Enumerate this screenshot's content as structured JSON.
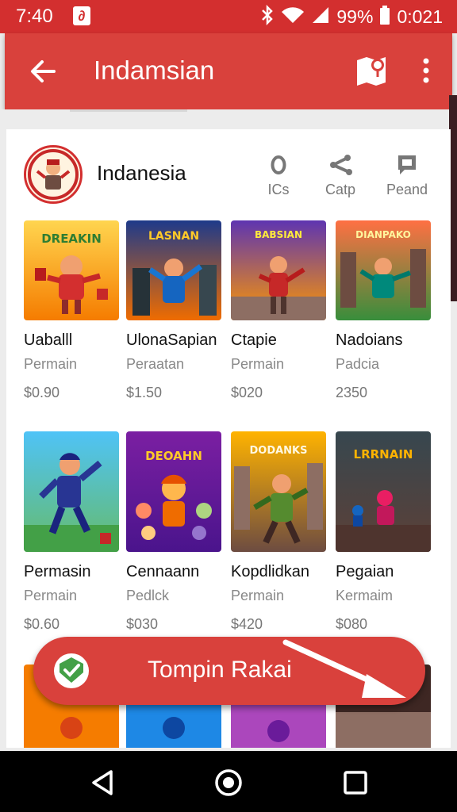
{
  "status_bar": {
    "time": "7:40",
    "battery": "99%",
    "clock": "0:021",
    "icons": [
      "notification-icon",
      "bluetooth-icon",
      "wifi-icon",
      "signal-icon",
      "battery-icon"
    ]
  },
  "app_bar": {
    "title": "Indamsian",
    "icons": [
      "back-arrow-icon",
      "map-pin-icon",
      "more-vert-icon"
    ]
  },
  "developer": {
    "name": "Indanesia",
    "stats": [
      {
        "label": "ICs",
        "icon": "circle-icon"
      },
      {
        "label": "Catp",
        "icon": "share-icon"
      },
      {
        "label": "Peand",
        "icon": "comment-icon"
      }
    ]
  },
  "apps": [
    {
      "name": "Uaballl",
      "sub": "Permain",
      "price": "$0.90"
    },
    {
      "name": "UlonaSapian",
      "sub": "Peraatan",
      "price": "$1.50"
    },
    {
      "name": "Ctapie",
      "sub": "Permain",
      "price": "$020"
    },
    {
      "name": "Nadoians",
      "sub": "Padcia",
      "price": "2350"
    },
    {
      "name": "Permasin",
      "sub": "Permain",
      "price": "$0.60"
    },
    {
      "name": "Cennaann",
      "sub": "Pedlck",
      "price": "$030"
    },
    {
      "name": "Kopdlidkan",
      "sub": "Permain",
      "price": "$420"
    },
    {
      "name": "Pegaian",
      "sub": "Kermaim",
      "price": "$080"
    }
  ],
  "thumb_text": {
    "t1": "DREAKIN",
    "t2": "LASNAN",
    "t3": "BABSIAN",
    "t4": "DIANPAKO",
    "t6": "DEOAHN",
    "t7": "DODANKS",
    "t8": "LRRNAIN"
  },
  "install_button": {
    "label": "Tompin Rakai"
  },
  "nav_bar": {
    "icons": [
      "back-triangle-icon",
      "home-circle-icon",
      "recents-square-icon"
    ]
  },
  "colors": {
    "primary": "#d9413c",
    "status_bar": "#d32f2f"
  }
}
